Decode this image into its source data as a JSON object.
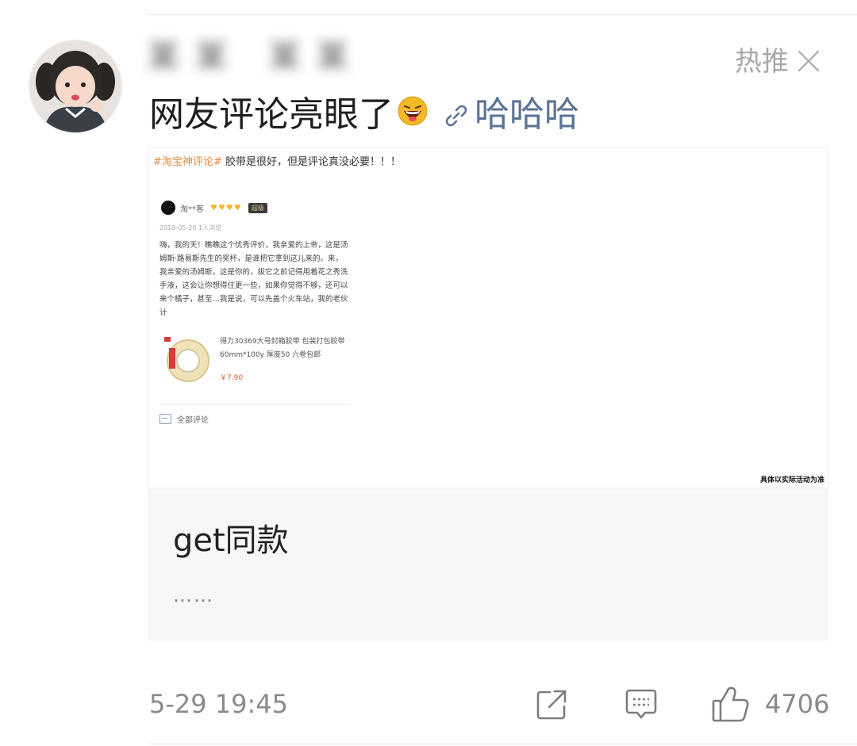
{
  "post": {
    "username": "某某 某某",
    "hot_label": "热推",
    "text": "网友评论亮眼了",
    "link_label": "哈哈哈",
    "time": "5-29 19:45",
    "like_count": "4706"
  },
  "icons": {
    "close": "close-icon",
    "emoji": "laughing-emoji-icon",
    "link": "link-icon",
    "share": "share-icon",
    "comment": "comment-icon",
    "like": "thumbs-up-icon"
  },
  "embedded_screenshot": {
    "headline_tag": "#淘宝神评论#",
    "headline_text": "胶带是很好，但是评论真没必要！！！",
    "reviewer": "淘**客",
    "stars": "♥♥♥♥",
    "badge": "超级",
    "date": "2019-05-20 1人浏览",
    "review": "嗨，我的天！瞧瞧这个优秀评价，我亲爱的上帝，这是汤姆斯·路易斯先生的奖杯，是谁把它拿到这儿来的。来，我亲爱的汤姆斯，这是你的，拔它之前记得用着花之秀洗手液，这会让你想得住更一些，如果你觉得不够，还可以来个橘子，甚至…我是说，可以先盖个火车站，我的老伙计",
    "product_name": "得力30369大号封箱胶带 包装打包胶带 60mm*100y 厚度50 六卷包邮",
    "price": "￥7.90",
    "all_comments": "全部评论",
    "disclaimer": "具体以实际活动为准"
  },
  "card": {
    "title": "get同款",
    "summary": "……"
  },
  "colors": {
    "link": "#5b7396",
    "meta_gray": "#8a8a8a",
    "card_bg": "#f7f7f7",
    "tag_orange": "#e98a3c"
  }
}
